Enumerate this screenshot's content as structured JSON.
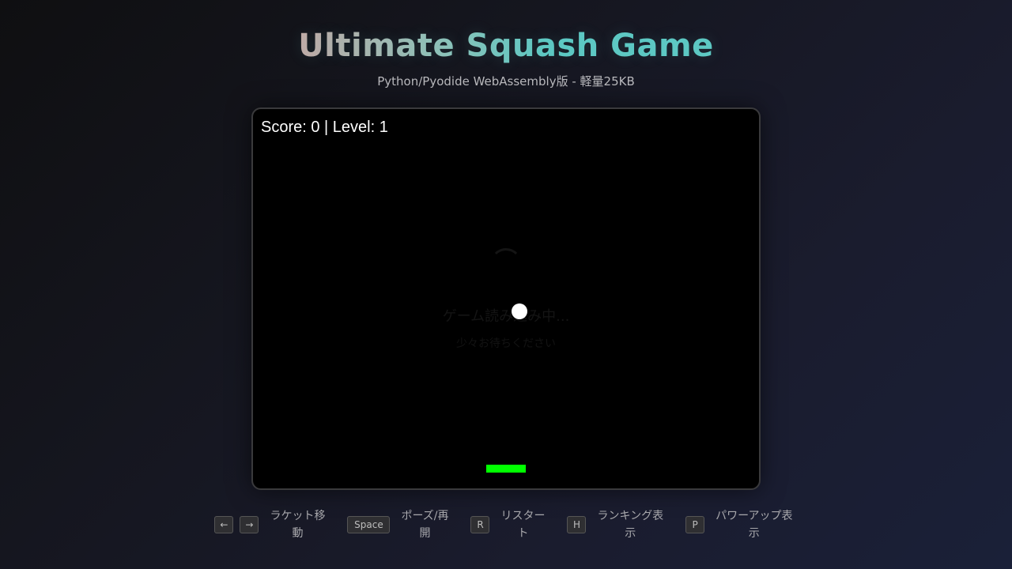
{
  "header": {
    "title": "Ultimate Squash Game",
    "subtitle": "Python/Pyodide WebAssembly版 - 軽量25KB"
  },
  "game": {
    "hud": "Score: 0 | Level: 1",
    "loading_text": "ゲーム読み込み中...",
    "loading_sub": "少々お待ちください",
    "colors": {
      "ball": "#ffffff",
      "paddle": "#00ff00",
      "background": "#000000"
    }
  },
  "controls": [
    {
      "keys": [
        "←",
        "→"
      ],
      "label_line1": "ラケット移",
      "label_line2": "動"
    },
    {
      "keys": [
        "Space"
      ],
      "label_line1": "ポーズ/再",
      "label_line2": "開"
    },
    {
      "keys": [
        "R"
      ],
      "label_line1": "リスター",
      "label_line2": "ト"
    },
    {
      "keys": [
        "H"
      ],
      "label_line1": "ランキング表",
      "label_line2": "示"
    },
    {
      "keys": [
        "P"
      ],
      "label_line1": "パワーアップ表",
      "label_line2": "示"
    }
  ]
}
